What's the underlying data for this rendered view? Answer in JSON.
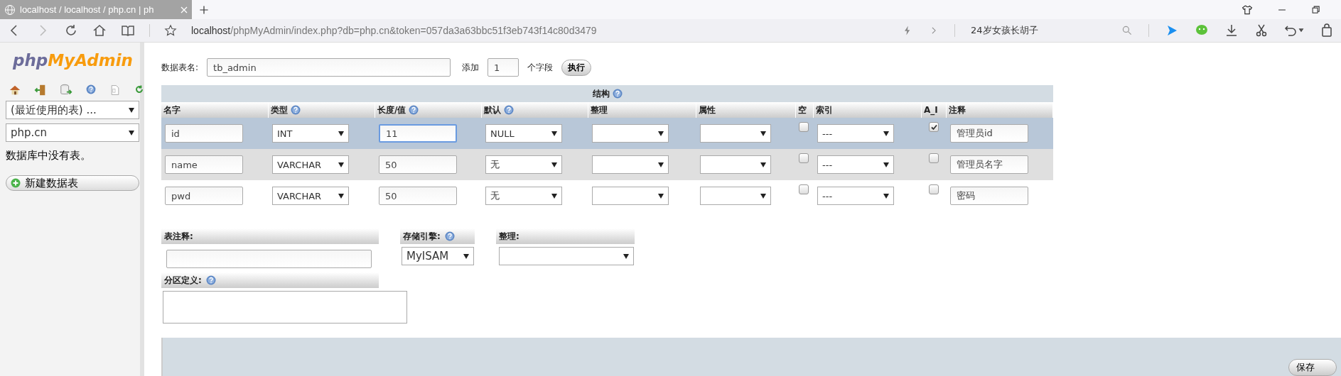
{
  "browser": {
    "tab_title": "localhost / localhost / php.cn | ph",
    "url_host": "localhost",
    "url_path": "/phpMyAdmin/index.php?db=php.cn&token=057da3a63bbc51f3eb743f14c80d3479",
    "search_text": "24岁女孩长胡子"
  },
  "sidebar": {
    "logo_php": "php",
    "logo_myadmin": "MyAdmin",
    "recent_tables": "(最近使用的表) ...",
    "database": "php.cn",
    "message": "数据库中没有表。",
    "new_table_button": "新建数据表"
  },
  "form": {
    "table_name_label": "数据表名:",
    "table_name": "tb_admin",
    "add_label": "添加",
    "add_count": "1",
    "fields_label": "个字段",
    "go_button": "执行"
  },
  "structure": {
    "title": "结构",
    "columns": [
      {
        "label": "名字",
        "help": false
      },
      {
        "label": "类型",
        "help": true
      },
      {
        "label": "长度/值",
        "help": true
      },
      {
        "label": "默认",
        "help": true
      },
      {
        "label": "整理",
        "help": false
      },
      {
        "label": "属性",
        "help": false
      },
      {
        "label": "空",
        "help": false
      },
      {
        "label": "索引",
        "help": false
      },
      {
        "label": "A_I",
        "help": false
      },
      {
        "label": "注释",
        "help": false
      }
    ],
    "rows": [
      {
        "selected": true,
        "name": "id",
        "type": "INT",
        "length": "11",
        "length_focused": true,
        "default": "NULL",
        "null": false,
        "index": "---",
        "auto_increment": true,
        "comment": "管理员id"
      },
      {
        "selected": false,
        "name": "name",
        "type": "VARCHAR",
        "length": "50",
        "length_focused": false,
        "default": "无",
        "null": false,
        "index": "---",
        "auto_increment": false,
        "comment": "管理员名字"
      },
      {
        "selected": false,
        "name": "pwd",
        "type": "VARCHAR",
        "length": "50",
        "length_focused": false,
        "default": "无",
        "null": false,
        "index": "---",
        "auto_increment": false,
        "comment": "密码"
      }
    ]
  },
  "options": {
    "table_comment_label": "表注释:",
    "engine_label": "存储引擎:",
    "engine": "MyISAM",
    "collation_label": "整理:",
    "partition_label": "分区定义:"
  },
  "save_button": "保存"
}
